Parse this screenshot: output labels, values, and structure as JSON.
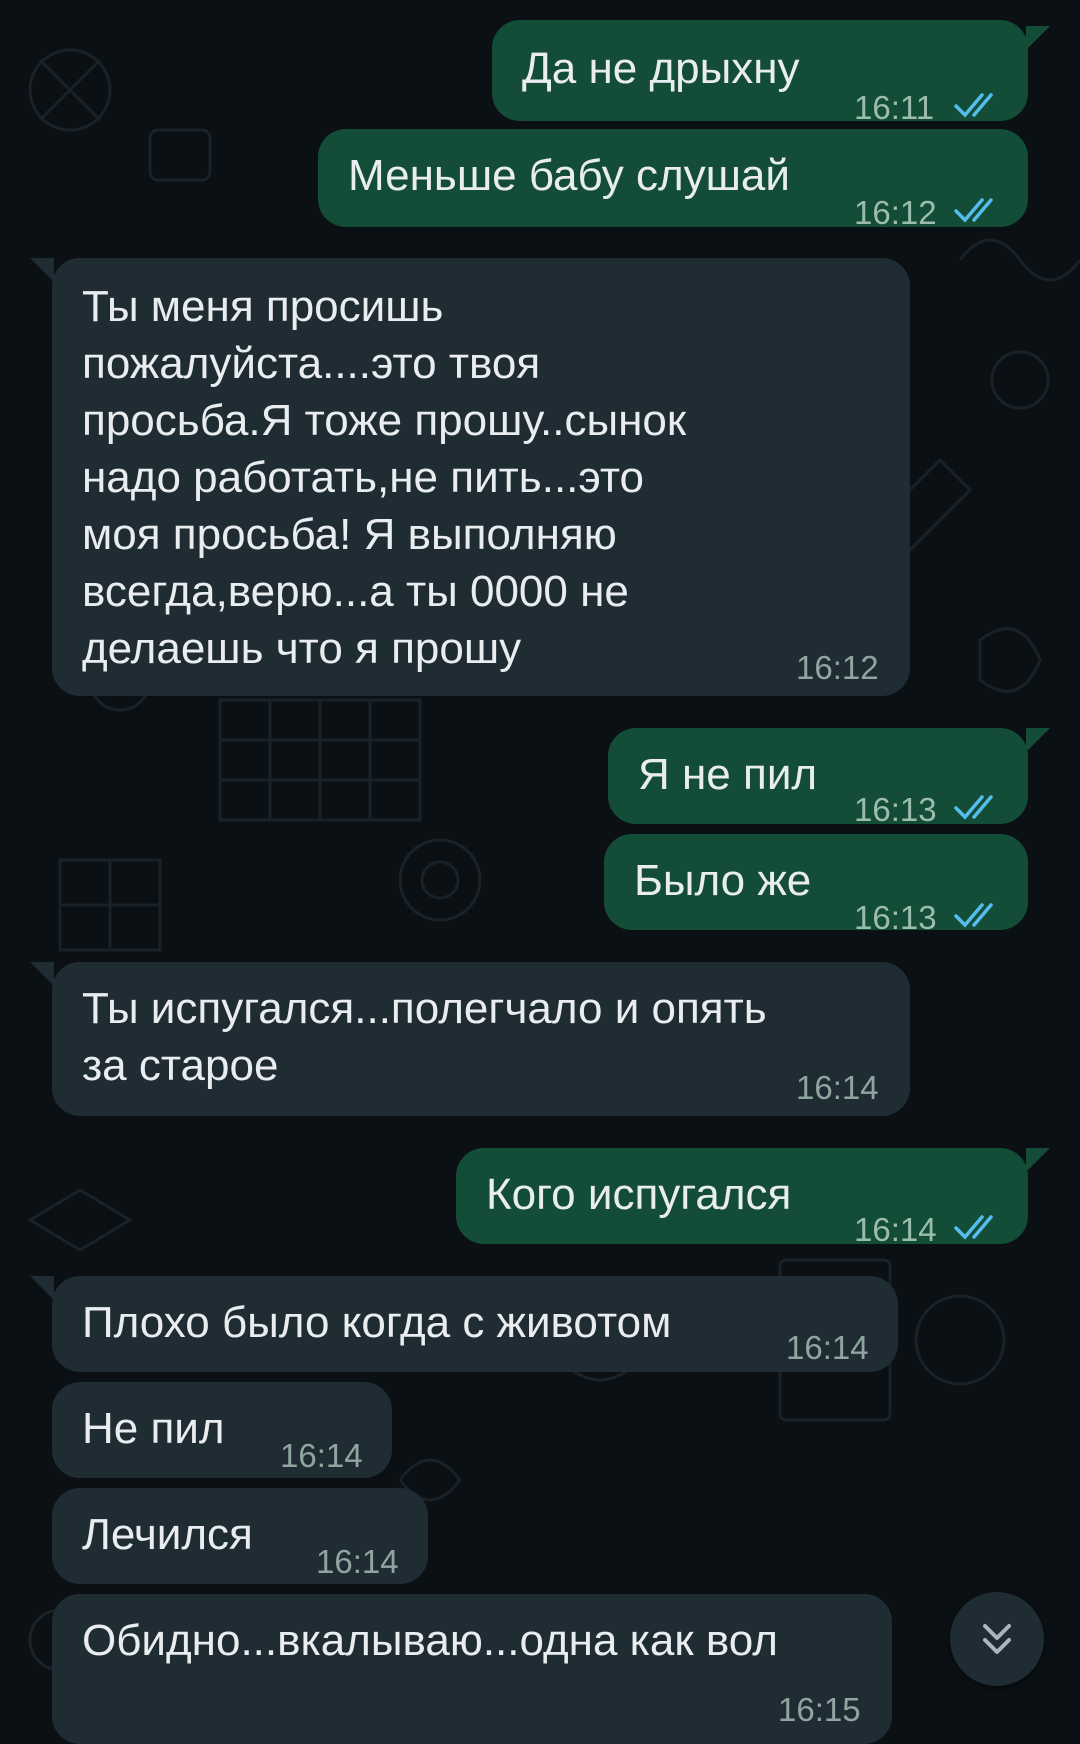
{
  "colors": {
    "background": "#0b1014",
    "outgoing_bubble": "#144d37",
    "incoming_bubble": "#1f2c34",
    "read_ticks": "#53bdeb"
  },
  "messages": [
    {
      "direction": "out",
      "text": "Да не дрыхну",
      "time": "16:11",
      "status": "read"
    },
    {
      "direction": "out",
      "text": "Меньше бабу слушай",
      "time": "16:12",
      "status": "read"
    },
    {
      "direction": "in",
      "lines": [
        "Ты меня просишь",
        "пожалуйста....это твоя",
        "просьба.Я тоже прошу..сынок",
        "надо работать,не пить...это",
        "моя просьба! Я выполняю",
        "всегда,верю...а ты 0000 не",
        "делаешь что я прошу"
      ],
      "time": "16:12"
    },
    {
      "direction": "out",
      "text": "Я не пил",
      "time": "16:13",
      "status": "read"
    },
    {
      "direction": "out",
      "text": "Было же",
      "time": "16:13",
      "status": "read"
    },
    {
      "direction": "in",
      "lines": [
        "Ты испугался...полегчало и опять",
        "за старое"
      ],
      "time": "16:14"
    },
    {
      "direction": "out",
      "text": "Кого испугался",
      "time": "16:14",
      "status": "read"
    },
    {
      "direction": "in",
      "text": "Плохо было когда с животом",
      "time": "16:14"
    },
    {
      "direction": "in",
      "text": "Не пил",
      "time": "16:14"
    },
    {
      "direction": "in",
      "text": "Лечился",
      "time": "16:14"
    },
    {
      "direction": "in",
      "text": "Обидно...вкалываю...одна как вол",
      "time": "16:15"
    }
  ],
  "scroll_button": {
    "icon": "double-chevron-down-icon"
  }
}
